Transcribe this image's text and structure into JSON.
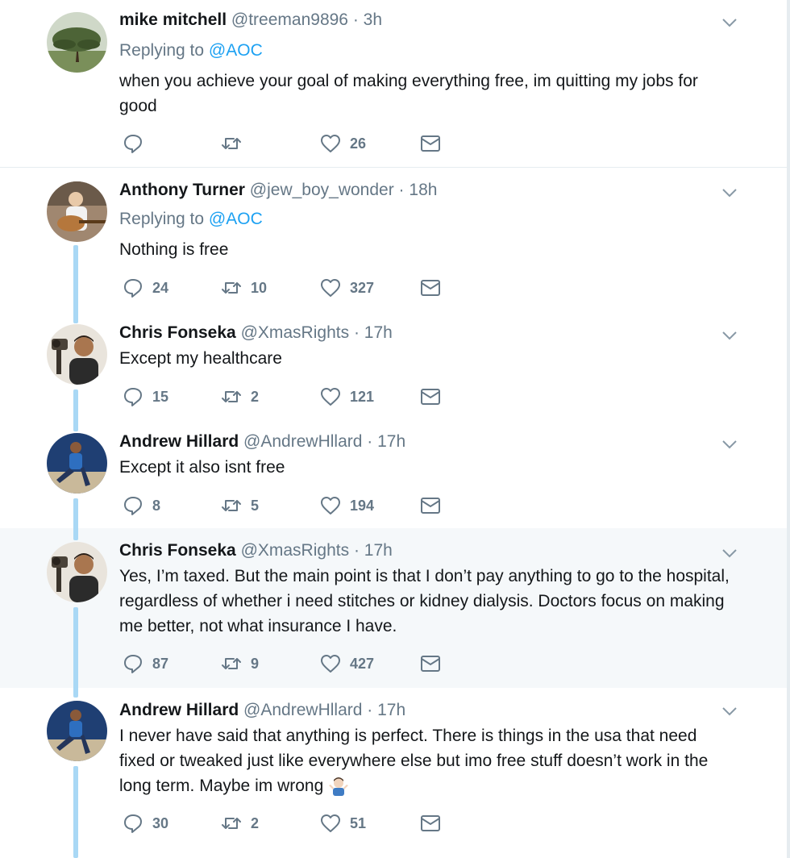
{
  "tweets": [
    {
      "name": "mike mitchell",
      "handle": "@treeman9896",
      "time": "3h",
      "replying_prefix": "Replying to",
      "replying_to": "@AOC",
      "text": "when you achieve your goal of making everything free, im quitting my jobs for good",
      "replies": "",
      "retweets": "",
      "likes": "26",
      "avatar": "tree-avatar"
    },
    {
      "name": "Anthony Turner",
      "handle": "@jew_boy_wonder",
      "time": "18h",
      "replying_prefix": "Replying to",
      "replying_to": "@AOC",
      "text": "Nothing is free",
      "replies": "24",
      "retweets": "10",
      "likes": "327",
      "avatar": "guitar-avatar"
    },
    {
      "name": "Chris Fonseka",
      "handle": "@XmasRights",
      "time": "17h",
      "text": "Except my healthcare",
      "replies": "15",
      "retweets": "2",
      "likes": "121",
      "avatar": "camera-avatar"
    },
    {
      "name": "Andrew Hillard",
      "handle": "@AndrewHllard",
      "time": "17h",
      "text": "Except it also isnt free",
      "replies": "8",
      "retweets": "5",
      "likes": "194",
      "avatar": "sitting-avatar"
    },
    {
      "name": "Chris Fonseka",
      "handle": "@XmasRights",
      "time": "17h",
      "text": "Yes, I’m taxed. But the main point is that I don’t pay anything to go to the hospital, regardless of whether i need stitches or kidney dialysis. Doctors focus on making me better, not what insurance I have.",
      "replies": "87",
      "retweets": "9",
      "likes": "427",
      "avatar": "camera-avatar"
    },
    {
      "name": "Andrew Hillard",
      "handle": "@AndrewHllard",
      "time": "17h",
      "text": "I never have said that anything is perfect. There is things in the usa that need fixed or tweaked just like everywhere else but imo free stuff doesn’t work in the long term. Maybe im wrong",
      "replies": "30",
      "retweets": "2",
      "likes": "51",
      "avatar": "sitting-avatar",
      "emoji": "man-shrugging-emoji"
    }
  ],
  "separator": "·",
  "colors": {
    "link": "#1da1f2",
    "muted": "#657786",
    "thread": "#a9d8f5",
    "highlight": "#f5f8fa"
  }
}
